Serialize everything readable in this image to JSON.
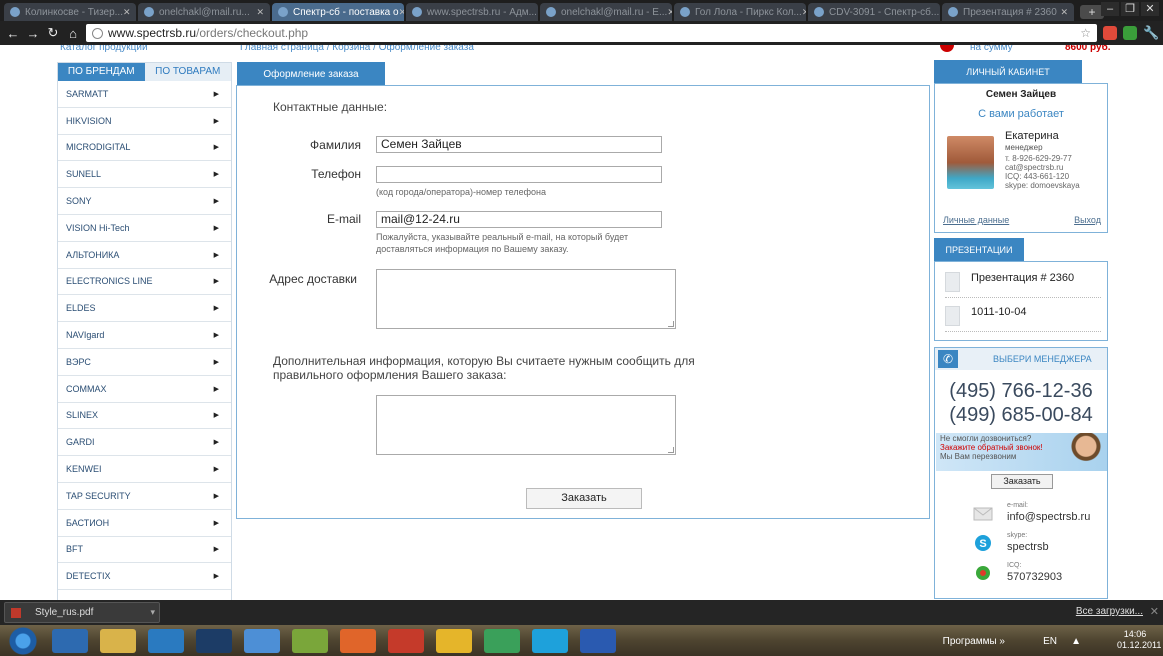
{
  "browser": {
    "tabs": [
      {
        "label": "Колинкосве - Тизер..."
      },
      {
        "label": "onelchakl@mail.ru..."
      },
      {
        "label": "Спектр-сб - поставка о",
        "active": true
      },
      {
        "label": "www.spectrsb.ru - Адм..."
      },
      {
        "label": "onelchakl@mail.ru - E..."
      },
      {
        "label": "Гол Лола - Пиркс Кол..."
      },
      {
        "label": "CDV-3091 - Спектр-сб..."
      },
      {
        "label": "Презентация # 2360"
      }
    ],
    "new_tab_label": "+",
    "url_host": "www.spectrsb.ru",
    "url_path": "/orders/checkout.php"
  },
  "breadcrumbs": {
    "left": "Каталог продукции",
    "trail": "Главная страница / Корзина / Оформление заказа"
  },
  "cart": {
    "label": "на сумму",
    "sum": "8600",
    "currency": "руб."
  },
  "left": {
    "tab_brands": "ПО БРЕНДАМ",
    "tab_products": "ПО ТОВАРАМ",
    "brands": [
      "SARMATT",
      "HIKVISION",
      "MICRODIGITAL",
      "SUNELL",
      "SONY",
      "VISION Hi-Tech",
      "АЛЬТОНИКА",
      "ELECTRONICS LINE",
      "ELDES",
      "NAVIgard",
      "ВЭРС",
      "COMMAX",
      "SLINEX",
      "GARDI",
      "KENWEI",
      "TAP SECURITY",
      "БАСТИОН",
      "BFT",
      "DETECTIX"
    ]
  },
  "form": {
    "tab_label": "Оформление заказа",
    "contacts_title": "Контактные данные:",
    "surname_label": "Фамилия",
    "surname_value": "Семен Зайцев",
    "phone_label": "Телефон",
    "phone_value": "",
    "phone_hint": "(код города/оператора)-номер телефона",
    "email_label": "E-mail",
    "email_value": "mail@12-24.ru",
    "email_hint_1": "Пожалуйста, указывайте реальный e-mail, на который будет",
    "email_hint_2": "доставляться информация по Вашему заказу.",
    "address_label": "Адрес доставки",
    "extra_title_1": "Дополнительная информация, которую Вы считаете нужным сообщить для",
    "extra_title_2": "правильного оформления Вашего заказа:",
    "submit_label": "Заказать"
  },
  "account": {
    "tab_label": "ЛИЧНЫЙ КАБИНЕТ",
    "user_name": "Семен Зайцев",
    "works_with": "С вами работает",
    "manager_name": "Екатерина",
    "manager_role": "менеджер",
    "manager_phone": "т. 8-926-629-29-77",
    "manager_email": "cat@spectrsb.ru",
    "manager_icq": "ICQ: 443-661-120",
    "manager_skype": "skype: domoevskaya",
    "personal_link": "Личные данные",
    "logout_link": "Выход"
  },
  "presentations": {
    "tab_label": "ПРЕЗЕНТАЦИИ",
    "items": [
      "Презентация # 2360",
      "1011-10-04"
    ]
  },
  "contacts": {
    "choose_manager": "ВЫБЕРИ МЕНЕДЖЕРА",
    "phone_1": "(495) 766-12-36",
    "phone_2": "(499) 685-00-84",
    "callback_l1": "Не смогли дозвониться?",
    "callback_l2": "Закажите обратный звонок!",
    "callback_l3": "Мы Вам перезвоним",
    "callback_button": "Заказать",
    "email_small": "e-mail:",
    "email": "info@spectrsb.ru",
    "skype_small": "skype:",
    "skype": "spectrsb",
    "icq_small": "ICQ:",
    "icq": "570732903"
  },
  "downloads": {
    "file": "Style_rus.pdf",
    "all_label": "Все загрузки..."
  },
  "taskbar": {
    "programs_label": "Программы",
    "lang": "EN",
    "time": "14:06",
    "date": "01.12.2011"
  }
}
